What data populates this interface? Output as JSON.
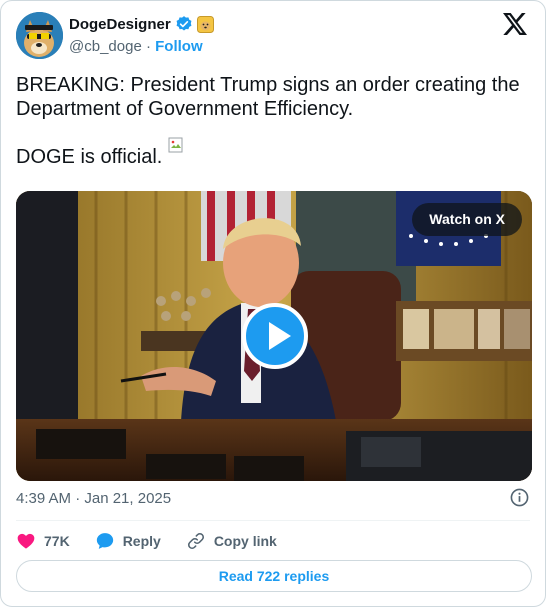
{
  "author": {
    "display_name": "DogeDesigner",
    "handle": "@cb_doge",
    "separator": "·",
    "follow_label": "Follow"
  },
  "tweet": {
    "line1": "BREAKING: President Trump signs an order creating the Department of Government Efficiency.",
    "line2": "DOGE is official."
  },
  "media": {
    "watch_label": "Watch on X"
  },
  "meta": {
    "timestamp": "4:39 AM · Jan 21, 2025"
  },
  "actions": {
    "likes": "77K",
    "reply_label": "Reply",
    "copy_link_label": "Copy link"
  },
  "footer": {
    "read_replies_label": "Read 722 replies"
  },
  "colors": {
    "accent": "#1d9bf0",
    "like": "#f91880",
    "text": "#0f1419",
    "secondary": "#536471"
  },
  "icons": [
    "doge-avatar",
    "verified-badge-icon",
    "doge-emoji-icon",
    "x-logo-icon",
    "broken-image-icon",
    "play-icon",
    "info-icon",
    "heart-icon",
    "reply-icon",
    "link-icon"
  ]
}
